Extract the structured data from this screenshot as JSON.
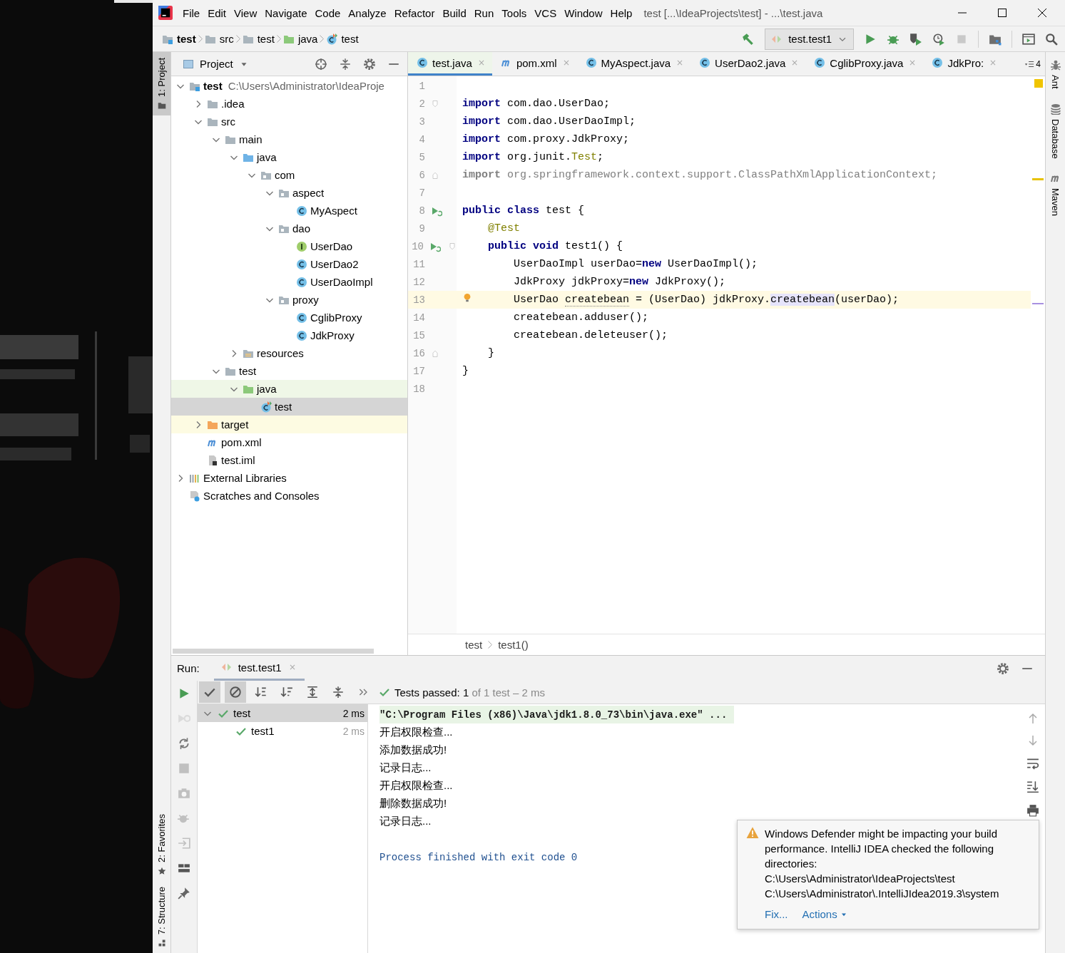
{
  "window": {
    "title": "test [...\\IdeaProjects\\test] - ...\\test.java",
    "menu": [
      "File",
      "Edit",
      "View",
      "Navigate",
      "Code",
      "Analyze",
      "Refactor",
      "Build",
      "Run",
      "Tools",
      "VCS",
      "Window",
      "Help"
    ]
  },
  "navigation": {
    "breadcrumbs": [
      {
        "label": "test",
        "kind": "project"
      },
      {
        "label": "src",
        "kind": "folder"
      },
      {
        "label": "test",
        "kind": "folder"
      },
      {
        "label": "java",
        "kind": "test-root"
      },
      {
        "label": "test",
        "kind": "test-class"
      }
    ],
    "run_configuration": "test.test1"
  },
  "left_tool_strip": {
    "top": [
      {
        "label": "1: Project",
        "kind": "project",
        "selected": true
      }
    ],
    "bottom": [
      {
        "label": "2: Favorites",
        "kind": "favorites",
        "selected": false
      },
      {
        "label": "7: Structure",
        "kind": "structure",
        "selected": false
      }
    ]
  },
  "right_tool_strip": [
    {
      "label": "Ant",
      "kind": "ant"
    },
    {
      "label": "Database",
      "kind": "database"
    },
    {
      "label": "Maven",
      "kind": "maven"
    }
  ],
  "project_panel": {
    "title": "Project",
    "tree": [
      {
        "label": "test",
        "path": "C:\\Users\\Administrator\\IdeaProje",
        "kind": "project",
        "selected": false,
        "expanded": true,
        "children": [
          {
            "label": ".idea",
            "kind": "folder",
            "selected": false,
            "expanded": false
          },
          {
            "label": "src",
            "kind": "folder",
            "selected": false,
            "expanded": true,
            "children": [
              {
                "label": "main",
                "kind": "folder",
                "selected": false,
                "expanded": true,
                "children": [
                  {
                    "label": "java",
                    "kind": "source-root",
                    "selected": false,
                    "expanded": true,
                    "children": [
                      {
                        "label": "com",
                        "kind": "package",
                        "selected": false,
                        "expanded": true,
                        "children": [
                          {
                            "label": "aspect",
                            "kind": "package",
                            "selected": false,
                            "expanded": true,
                            "children": [
                              {
                                "label": "MyAspect",
                                "kind": "class",
                                "selected": false
                              }
                            ]
                          },
                          {
                            "label": "dao",
                            "kind": "package",
                            "selected": false,
                            "expanded": true,
                            "children": [
                              {
                                "label": "UserDao",
                                "kind": "interface",
                                "selected": false
                              },
                              {
                                "label": "UserDao2",
                                "kind": "class",
                                "selected": false
                              },
                              {
                                "label": "UserDaoImpl",
                                "kind": "class",
                                "selected": false
                              }
                            ]
                          },
                          {
                            "label": "proxy",
                            "kind": "package",
                            "selected": false,
                            "expanded": true,
                            "children": [
                              {
                                "label": "CglibProxy",
                                "kind": "class",
                                "selected": false
                              },
                              {
                                "label": "JdkProxy",
                                "kind": "class",
                                "selected": false
                              }
                            ]
                          }
                        ]
                      }
                    ]
                  },
                  {
                    "label": "resources",
                    "kind": "resources",
                    "selected": false,
                    "expanded": false
                  }
                ]
              },
              {
                "label": "test",
                "kind": "folder",
                "selected": false,
                "expanded": true,
                "children": [
                  {
                    "label": "java",
                    "kind": "test-root",
                    "selected": false,
                    "expanded": true,
                    "children": [
                      {
                        "label": "test",
                        "kind": "test-class",
                        "selected": true
                      }
                    ]
                  }
                ]
              }
            ]
          },
          {
            "label": "target",
            "kind": "excluded",
            "selected": false,
            "expanded": false
          },
          {
            "label": "pom.xml",
            "kind": "maven",
            "selected": false
          },
          {
            "label": "test.iml",
            "kind": "iml",
            "selected": false
          }
        ]
      },
      {
        "label": "External Libraries",
        "kind": "libraries",
        "selected": false,
        "expanded": false
      },
      {
        "label": "Scratches and Consoles",
        "kind": "scratches",
        "selected": false
      }
    ]
  },
  "editor": {
    "tabs": [
      {
        "label": "test.java",
        "kind": "class",
        "selected": true
      },
      {
        "label": "pom.xml",
        "kind": "maven",
        "selected": false
      },
      {
        "label": "MyAspect.java",
        "kind": "class",
        "selected": false
      },
      {
        "label": "UserDao2.java",
        "kind": "class",
        "selected": false
      },
      {
        "label": "CglibProxy.java",
        "kind": "class",
        "selected": false
      },
      {
        "label": "JdkPro:",
        "kind": "class",
        "selected": false
      }
    ],
    "tab_count": "4",
    "lines": [
      {
        "number": "1",
        "current": false
      },
      {
        "number": "2",
        "current": false,
        "markers": [
          {
            "kind": "fold-start"
          }
        ],
        "tokens": [
          {
            "text": "import",
            "kind": "keyword"
          },
          {
            "text": " com.dao.UserDao;",
            "kind": "plain"
          }
        ]
      },
      {
        "number": "3",
        "current": false,
        "tokens": [
          {
            "text": "import",
            "kind": "keyword"
          },
          {
            "text": " com.dao.UserDaoImpl;",
            "kind": "plain"
          }
        ]
      },
      {
        "number": "4",
        "current": false,
        "tokens": [
          {
            "text": "import",
            "kind": "keyword"
          },
          {
            "text": " com.proxy.JdkProxy;",
            "kind": "plain"
          }
        ]
      },
      {
        "number": "5",
        "current": false,
        "tokens": [
          {
            "text": "import",
            "kind": "keyword"
          },
          {
            "text": " org.junit.",
            "kind": "plain"
          },
          {
            "text": "Test",
            "kind": "annotation"
          },
          {
            "text": ";",
            "kind": "plain"
          }
        ]
      },
      {
        "number": "6",
        "current": false,
        "markers": [
          {
            "kind": "fold-end"
          }
        ],
        "tokens": [
          {
            "text": "import",
            "kind": "unused-keyword"
          },
          {
            "text": " org.springframework.context.support.ClassPathXmlApplicationContext;",
            "kind": "unused"
          }
        ]
      },
      {
        "number": "7",
        "current": false
      },
      {
        "number": "8",
        "current": false,
        "markers": [
          {
            "kind": "run"
          }
        ],
        "tokens": [
          {
            "text": "public class",
            "kind": "keyword"
          },
          {
            "text": " test {",
            "kind": "plain"
          }
        ]
      },
      {
        "number": "9",
        "current": false,
        "tokens": [
          {
            "text": "    @Test",
            "kind": "annotation"
          }
        ]
      },
      {
        "number": "10",
        "current": false,
        "markers": [
          {
            "kind": "run"
          },
          {
            "kind": "fold-start"
          }
        ],
        "tokens": [
          {
            "text": "    public void",
            "kind": "keyword"
          },
          {
            "text": " test1() {",
            "kind": "plain"
          }
        ]
      },
      {
        "number": "11",
        "current": false,
        "tokens": [
          {
            "text": "        UserDaoImpl userDao=",
            "kind": "plain"
          },
          {
            "text": "new",
            "kind": "keyword"
          },
          {
            "text": " UserDaoImpl();",
            "kind": "plain"
          }
        ]
      },
      {
        "number": "12",
        "current": false,
        "tokens": [
          {
            "text": "        JdkProxy jdkProxy=",
            "kind": "plain"
          },
          {
            "text": "new",
            "kind": "keyword"
          },
          {
            "text": " JdkProxy();",
            "kind": "plain"
          }
        ]
      },
      {
        "number": "13",
        "current": true,
        "markers": [
          {
            "kind": "intention"
          }
        ],
        "tokens": [
          {
            "text": "        UserDao ",
            "kind": "plain"
          },
          {
            "text": "createbean",
            "kind": "unused-var"
          },
          {
            "text": " = (UserDao) jdkProxy.",
            "kind": "plain"
          },
          {
            "text": "createbean",
            "kind": "highlight"
          },
          {
            "text": "(userDao);",
            "kind": "plain"
          }
        ]
      },
      {
        "number": "14",
        "current": false,
        "tokens": [
          {
            "text": "        createbean.adduser();",
            "kind": "plain"
          }
        ]
      },
      {
        "number": "15",
        "current": false,
        "tokens": [
          {
            "text": "        createbean.deleteuser();",
            "kind": "plain"
          }
        ]
      },
      {
        "number": "16",
        "current": false,
        "markers": [
          {
            "kind": "fold-end"
          }
        ],
        "tokens": [
          {
            "text": "    }",
            "kind": "plain"
          }
        ]
      },
      {
        "number": "17",
        "current": false,
        "tokens": [
          {
            "text": "}",
            "kind": "plain"
          }
        ]
      },
      {
        "number": "18",
        "current": false
      }
    ],
    "breadcrumbs": [
      "test",
      "test1()"
    ]
  },
  "run_panel": {
    "label": "Run:",
    "tab": "test.test1",
    "side_tools": [
      {
        "kind": "rerun",
        "disabled": false
      },
      {
        "kind": "rerun-failed",
        "disabled": true
      },
      {
        "kind": "auto-test",
        "disabled": false
      },
      {
        "kind": "stop",
        "disabled": true
      },
      {
        "kind": "camera",
        "disabled": true
      },
      {
        "kind": "debug",
        "disabled": true
      },
      {
        "kind": "import",
        "disabled": true
      },
      {
        "kind": "layout",
        "disabled": false
      },
      {
        "kind": "pin",
        "disabled": false
      }
    ],
    "toolbar": [
      {
        "kind": "show-passed",
        "on": true
      },
      {
        "kind": "show-ignored",
        "on": true
      },
      {
        "kind": "sort-alpha",
        "on": false
      },
      {
        "kind": "sort-duration",
        "on": false
      },
      {
        "kind": "expand-all",
        "on": false
      },
      {
        "kind": "collapse-all",
        "on": false
      },
      {
        "kind": "more",
        "on": false
      }
    ],
    "status": {
      "summary": "Tests passed: 1",
      "detail": "of 1 test – 2 ms"
    },
    "tests": [
      {
        "name": "test",
        "time": "2 ms",
        "selected": true,
        "expanded": true,
        "children": [
          {
            "name": "test1",
            "time": "2 ms",
            "selected": false
          }
        ]
      }
    ],
    "console": [
      {
        "text": "\"C:\\Program Files (x86)\\Java\\jdk1.8.0_73\\bin\\java.exe\" ...",
        "kind": "command"
      },
      {
        "text": "开启权限检查...",
        "kind": "output"
      },
      {
        "text": "添加数据成功!",
        "kind": "output"
      },
      {
        "text": "记录日志...",
        "kind": "output"
      },
      {
        "text": "开启权限检查...",
        "kind": "output"
      },
      {
        "text": "删除数据成功!",
        "kind": "output"
      },
      {
        "text": "记录日志...",
        "kind": "output"
      },
      {
        "text": "Process finished with exit code 0",
        "kind": "exit"
      }
    ]
  },
  "notification": {
    "message": "Windows Defender might be impacting your build performance. IntelliJ IDEA checked the following directories:",
    "paths": [
      "C:\\Users\\Administrator\\IdeaProjects\\test",
      "C:\\Users\\Administrator\\.IntelliJIdea2019.3\\system"
    ],
    "actions": [
      {
        "label": "Fix...",
        "kind": "link"
      },
      {
        "label": "Actions",
        "kind": "menu"
      }
    ]
  }
}
